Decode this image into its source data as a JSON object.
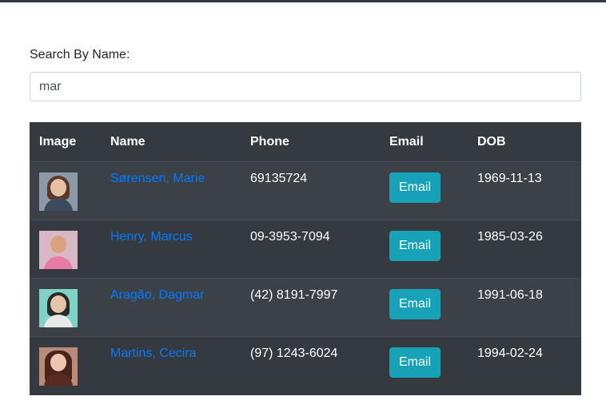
{
  "search": {
    "label": "Search By Name:",
    "value": "mar"
  },
  "table": {
    "headers": {
      "image": "Image",
      "name": "Name",
      "phone": "Phone",
      "email": "Email",
      "dob": "DOB"
    },
    "rows": [
      {
        "name": "Sørensen, Marie",
        "phone": "69135724",
        "email_label": "Email",
        "dob": "1969-11-13"
      },
      {
        "name": "Henry, Marcus",
        "phone": "09-3953-7094",
        "email_label": "Email",
        "dob": "1985-03-26"
      },
      {
        "name": "Aragão, Dagmar",
        "phone": "(42) 8191-7997",
        "email_label": "Email",
        "dob": "1991-06-18"
      },
      {
        "name": "Martins, Cecira",
        "phone": "(97) 1243-6024",
        "email_label": "Email",
        "dob": "1994-02-24"
      }
    ]
  },
  "colors": {
    "table_bg": "#343a40",
    "link": "#007bff",
    "button": "#17a2b8"
  }
}
